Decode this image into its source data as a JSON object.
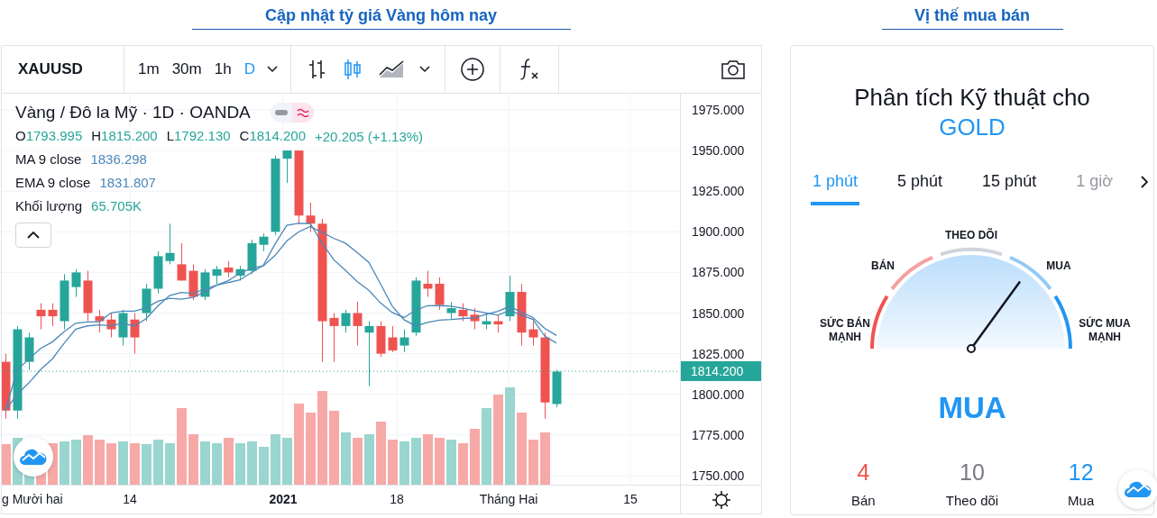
{
  "left_heading": "Cập nhật tỷ giá Vàng hôm nay",
  "right_heading": "Vị thế mua bán",
  "chart_widget": {
    "symbol": "XAUUSD",
    "intervals": [
      {
        "label": "1m",
        "selected": false
      },
      {
        "label": "30m",
        "selected": false
      },
      {
        "label": "1h",
        "selected": false
      },
      {
        "label": "D",
        "selected": true
      }
    ],
    "chart_types": [
      {
        "kind": "bars",
        "selected": false
      },
      {
        "kind": "candles",
        "selected": true
      },
      {
        "kind": "area",
        "selected": false
      }
    ],
    "legend": {
      "title": "Vàng / Đô la Mỹ · 1D · OANDA",
      "ohlc": [
        {
          "key": "O",
          "value": "1793.995"
        },
        {
          "key": "H",
          "value": "1815.200"
        },
        {
          "key": "L",
          "value": "1792.130"
        },
        {
          "key": "C",
          "value": "1814.200"
        }
      ],
      "change": "+20.205 (+1.13%)",
      "indicators": [
        {
          "name": "MA 9 close",
          "value": "1836.298",
          "kind": "line"
        },
        {
          "name": "EMA 9 close",
          "value": "1831.807",
          "kind": "line"
        },
        {
          "name": "Khối lượng",
          "value": "65.705K",
          "kind": "volume"
        }
      ]
    },
    "price_ticks": [
      "1975.000",
      "1950.000",
      "1925.000",
      "1900.000",
      "1875.000",
      "1850.000",
      "1825.000",
      "1800.000",
      "1775.000",
      "1750.000"
    ],
    "last_price": "1814.200",
    "time_labels": [
      {
        "label": "g Mười hai",
        "bold": false
      },
      {
        "label": "14",
        "bold": false
      },
      {
        "label": "2021",
        "bold": true
      },
      {
        "label": "18",
        "bold": false
      },
      {
        "label": "Tháng Hai",
        "bold": false
      },
      {
        "label": "15",
        "bold": false
      }
    ]
  },
  "analysis": {
    "title": "Phân tích Kỹ thuật cho",
    "symbol": "GOLD",
    "tabs": [
      {
        "label": "1 phút",
        "selected": true
      },
      {
        "label": "5 phút",
        "selected": false
      },
      {
        "label": "15 phút",
        "selected": false
      },
      {
        "label": "1 giờ",
        "selected": false
      }
    ],
    "gauge": {
      "labels": [
        "SỨC BÁN\nMẠNH",
        "BÁN",
        "THEO DÕI",
        "MUA",
        "SỨC MUA\nMẠNH"
      ]
    },
    "verdict": "MUA",
    "counts": [
      {
        "value": "4",
        "label": "Bán",
        "kind": "sell"
      },
      {
        "value": "10",
        "label": "Theo dõi",
        "kind": "neutral"
      },
      {
        "value": "12",
        "label": "Mua",
        "kind": "buy"
      }
    ]
  }
}
